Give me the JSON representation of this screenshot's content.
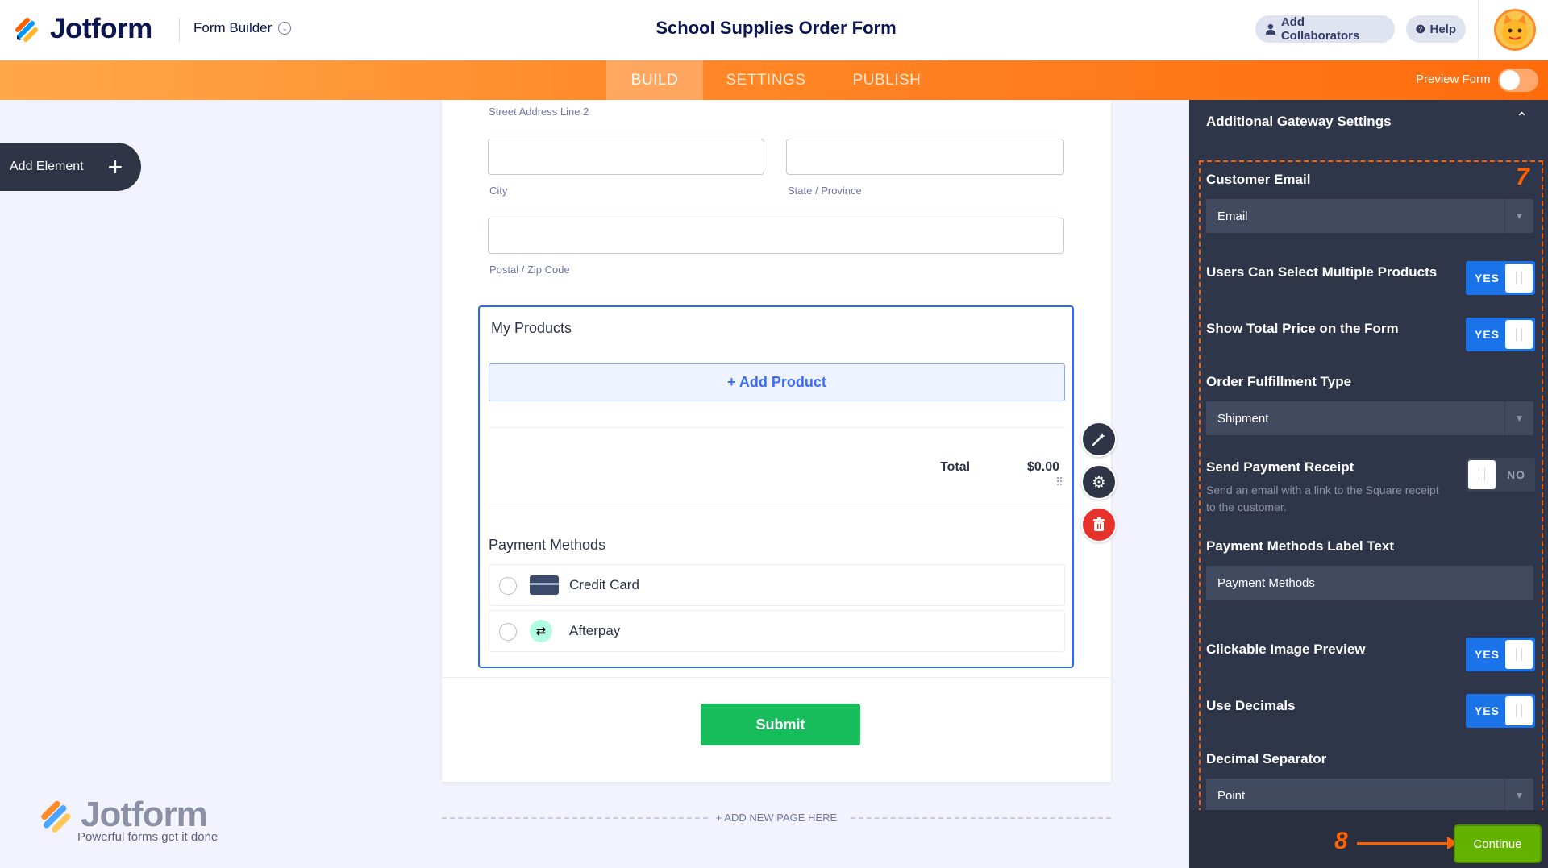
{
  "header": {
    "brand": "Jotform",
    "mode_label": "Form Builder",
    "form_title": "School Supplies Order Form",
    "collaborators_label": "Add Collaborators",
    "help_label": "Help"
  },
  "nav": {
    "tabs": [
      "BUILD",
      "SETTINGS",
      "PUBLISH"
    ],
    "active_tab": "BUILD",
    "preview_label": "Preview Form",
    "preview_on": false
  },
  "sidebar": {
    "add_element_label": "Add Element"
  },
  "form": {
    "street2_label": "Street Address Line 2",
    "city_label": "City",
    "state_label": "State / Province",
    "zip_label": "Postal / Zip Code",
    "products_title": "My Products",
    "add_product_label": "+ Add Product",
    "total_label": "Total",
    "total_value": "$0.00",
    "payment_methods_title": "Payment Methods",
    "payment_methods": [
      {
        "label": "Credit Card",
        "icon": "credit-card-icon"
      },
      {
        "label": "Afterpay",
        "icon": "afterpay-icon"
      }
    ],
    "submit_label": "Submit",
    "add_page_label": "+ ADD NEW PAGE HERE"
  },
  "watermark": {
    "brand": "Jotform",
    "tagline": "Powerful forms get it done"
  },
  "panel": {
    "title": "Additional Gateway Settings",
    "step7": "7",
    "step8": "8",
    "customer_email_label": "Customer Email",
    "customer_email_value": "Email",
    "multi_products_label": "Users Can Select Multiple Products",
    "multi_products_value": "YES",
    "total_price_label": "Show Total Price on the Form",
    "total_price_value": "YES",
    "fulfillment_label": "Order Fulfillment Type",
    "fulfillment_value": "Shipment",
    "receipt_label": "Send Payment Receipt",
    "receipt_desc": "Send an email with a link to the Square receipt to the customer.",
    "receipt_value": "NO",
    "pm_label_text_label": "Payment Methods Label Text",
    "pm_label_text_value": "Payment Methods",
    "image_preview_label": "Clickable Image Preview",
    "image_preview_value": "YES",
    "decimals_label": "Use Decimals",
    "decimals_value": "YES",
    "decimal_sep_label": "Decimal Separator",
    "decimal_sep_value": "Point",
    "continue_label": "Continue"
  },
  "colors": {
    "accent_orange": "#ff6100",
    "toggle_blue": "#1a73e8",
    "submit_green": "#18bd5b",
    "continue_green": "#64b200",
    "panel_bg": "#30364a"
  }
}
